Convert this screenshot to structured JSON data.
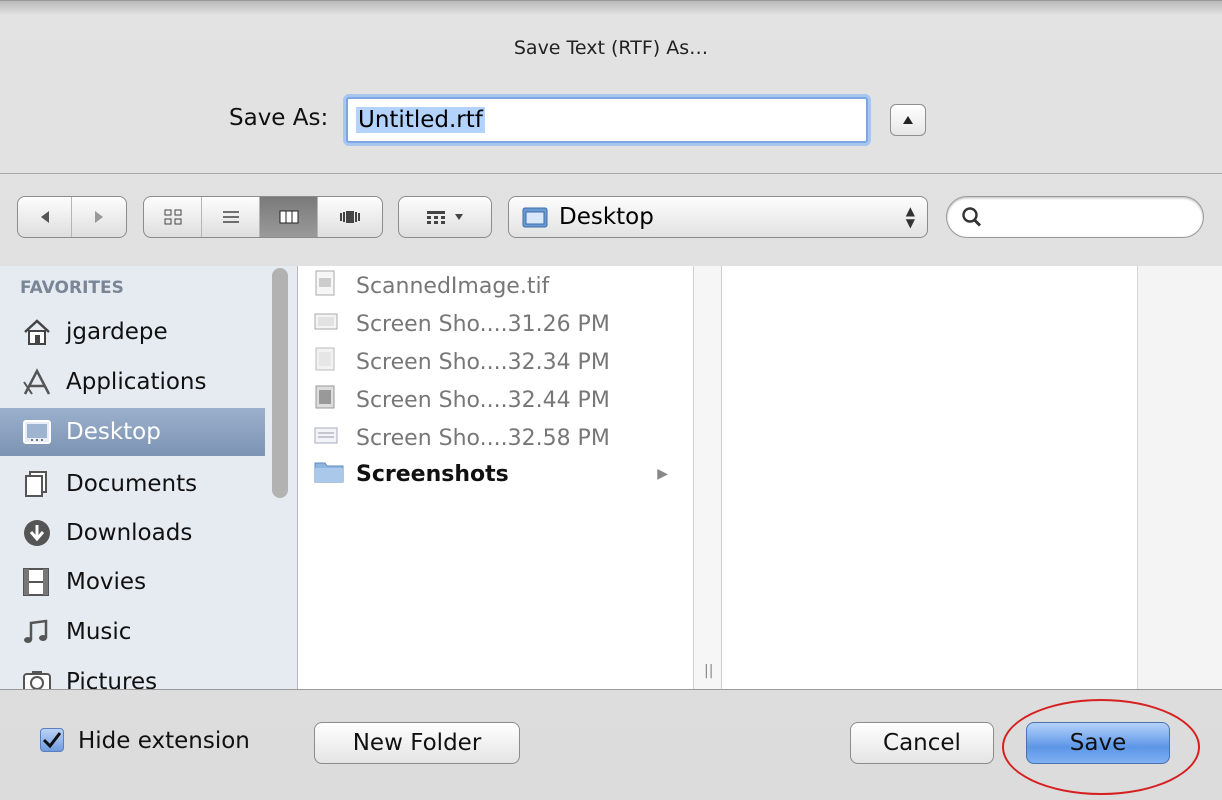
{
  "dialog": {
    "title": "Save Text (RTF) As…",
    "save_as_label": "Save As:",
    "filename_value": "Untitled.rtf"
  },
  "toolbar": {
    "back_icon": "back-arrow-icon",
    "forward_icon": "forward-arrow-icon",
    "view_modes": [
      "icon-view-icon",
      "list-view-icon",
      "column-view-icon",
      "coverflow-view-icon"
    ],
    "active_view": "column",
    "arrange_icon": "arrange-icon",
    "location": "Desktop",
    "search_placeholder": ""
  },
  "sidebar": {
    "group_label": "FAVORITES",
    "items": [
      {
        "label": "jgardepe",
        "icon": "home-icon"
      },
      {
        "label": "Applications",
        "icon": "applications-icon"
      },
      {
        "label": "Desktop",
        "icon": "desktop-icon",
        "selected": true
      },
      {
        "label": "Documents",
        "icon": "documents-icon"
      },
      {
        "label": "Downloads",
        "icon": "downloads-icon"
      },
      {
        "label": "Movies",
        "icon": "movies-icon"
      },
      {
        "label": "Music",
        "icon": "music-icon"
      },
      {
        "label": "Pictures",
        "icon": "pictures-icon"
      }
    ]
  },
  "files": [
    {
      "name": "ScannedImage.tif",
      "type": "file"
    },
    {
      "name": "Screen Sho....31.26 PM",
      "type": "file"
    },
    {
      "name": "Screen Sho....32.34 PM",
      "type": "file"
    },
    {
      "name": "Screen Sho....32.44 PM",
      "type": "file"
    },
    {
      "name": "Screen Sho....32.58 PM",
      "type": "file"
    },
    {
      "name": "Screenshots",
      "type": "folder"
    }
  ],
  "footer": {
    "hide_extension_label": "Hide extension",
    "hide_extension_checked": true,
    "new_folder_label": "New Folder",
    "cancel_label": "Cancel",
    "save_label": "Save"
  },
  "colors": {
    "selection_blue": "#b3d3fd",
    "default_button": "#5d96e8",
    "annotation_ring": "#d62020"
  }
}
